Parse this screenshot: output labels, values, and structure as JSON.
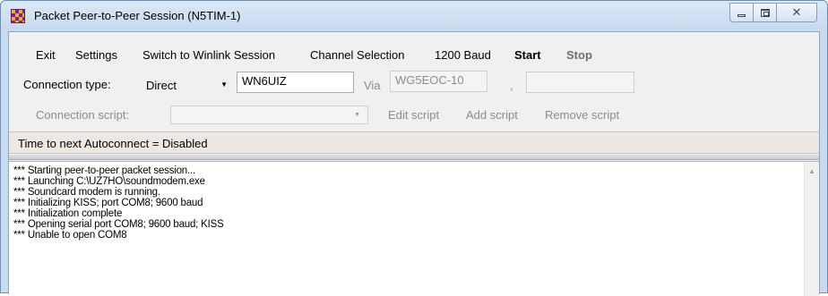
{
  "window": {
    "title": "Packet Peer-to-Peer Session  (N5TIM-1)"
  },
  "menu": {
    "exit": "Exit",
    "settings": "Settings",
    "switch": "Switch to Winlink Session",
    "channel": "Channel Selection",
    "baud": "1200 Baud",
    "start": "Start",
    "stop": "Stop"
  },
  "connection": {
    "type_label": "Connection type:",
    "type_value": "Direct",
    "callsign": "WN6UIZ",
    "via_label": "Via",
    "via_value": "WG5EOC-10",
    "comma": ",",
    "via2_value": ""
  },
  "script": {
    "label": "Connection script:",
    "value": "",
    "edit": "Edit script",
    "add": "Add script",
    "remove": "Remove script"
  },
  "status": {
    "text": "Time to next Autoconnect = Disabled"
  },
  "log": [
    "*** Starting peer-to-peer packet session...",
    "*** Launching C:\\UZ7HO\\soundmodem.exe",
    "*** Soundcard modem is running.",
    "*** Initializing KISS; port COM8; 9600 baud",
    "*** Initialization complete",
    "*** Opening serial port COM8; 9600 baud; KISS",
    "*** Unable to open COM8"
  ],
  "icons": {
    "app": "app-grid-icon",
    "minimize": "minimize-icon",
    "maximize": "maximize-icon",
    "close": "close-icon",
    "dropdown": "chevron-down-icon",
    "scroll_up": "scroll-up-icon"
  }
}
